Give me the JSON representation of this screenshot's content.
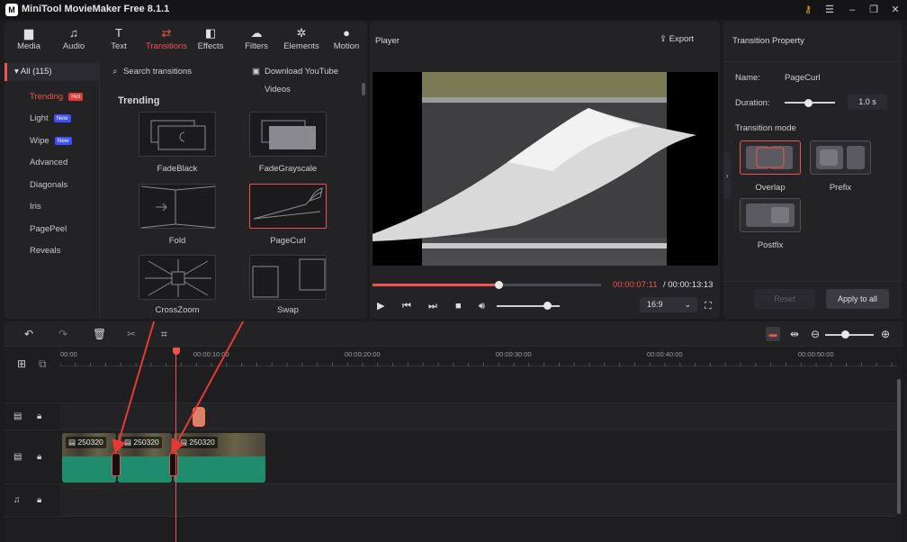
{
  "app": {
    "title": "MiniTool MovieMaker Free 8.1.1",
    "logo_text": "M"
  },
  "window_controls": [
    "key-icon",
    "menu-icon",
    "minimize-icon",
    "maximize-icon",
    "close-icon"
  ],
  "tabs": [
    {
      "label": "Media",
      "icon": "folder-icon",
      "glyph": "▆"
    },
    {
      "label": "Audio",
      "icon": "music-icon",
      "glyph": "♫"
    },
    {
      "label": "Text",
      "icon": "text-icon",
      "glyph": "T"
    },
    {
      "label": "Transitions",
      "icon": "transitions-icon",
      "glyph": "⇄"
    },
    {
      "label": "Effects",
      "icon": "effects-icon",
      "glyph": "◧"
    },
    {
      "label": "Filters",
      "icon": "filters-icon",
      "glyph": "☁"
    },
    {
      "label": "Elements",
      "icon": "elements-icon",
      "glyph": "✲"
    },
    {
      "label": "Motion",
      "icon": "motion-icon",
      "glyph": "●"
    }
  ],
  "categories": {
    "all_label": "All (115)",
    "items": [
      {
        "label": "Trending",
        "badge": "Hot",
        "active": true
      },
      {
        "label": "Light",
        "badge": "New"
      },
      {
        "label": "Wipe",
        "badge": "New"
      },
      {
        "label": "Advanced"
      },
      {
        "label": "Diagonals"
      },
      {
        "label": "Iris"
      },
      {
        "label": "PagePeel"
      },
      {
        "label": "Reveals"
      }
    ]
  },
  "search": {
    "placeholder": "Search transitions",
    "download_label": "Download YouTube Videos"
  },
  "section": {
    "title": "Trending"
  },
  "transitions": [
    {
      "label": "FadeBlack"
    },
    {
      "label": "FadeGrayscale"
    },
    {
      "label": "Fold"
    },
    {
      "label": "PageCurl",
      "selected": true
    },
    {
      "label": "CrossZoom"
    },
    {
      "label": "Swap"
    }
  ],
  "player": {
    "header": "Player",
    "export_label": "Export",
    "current_time": "00:00:07:11",
    "total_time": "/ 00:00:13:13",
    "progress": 0.55,
    "volume": 0.8,
    "aspect_ratio": "16:9"
  },
  "properties": {
    "header": "Transition Property",
    "name_label": "Name:",
    "name_value": "PageCurl",
    "duration_label": "Duration:",
    "duration_value": "1.0 s",
    "mode_label": "Transition mode",
    "modes": [
      {
        "label": "Overlap",
        "selected": true
      },
      {
        "label": "Prefix"
      },
      {
        "label": "Postfix"
      }
    ],
    "reset_label": "Reset",
    "apply_label": "Apply to all"
  },
  "timeline": {
    "ruler": [
      "00:00",
      "00:00:10:00",
      "00:00:20:00",
      "00:00:30:00",
      "00:00:40:00",
      "00:00:50:00"
    ],
    "clips": [
      {
        "label": "250320"
      },
      {
        "label": "250320"
      },
      {
        "label": "250320"
      }
    ]
  },
  "colors": {
    "accent": "#ef5350",
    "waveform": "#1f8c6e",
    "background": "#1c1c1f"
  }
}
